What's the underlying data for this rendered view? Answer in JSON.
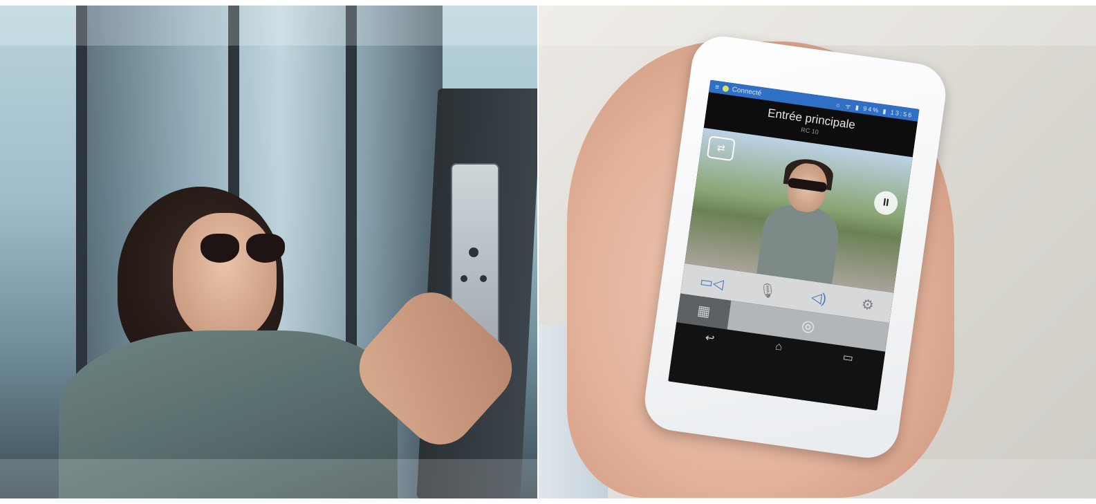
{
  "left_scene": {
    "description_labels": []
  },
  "phone_app": {
    "status_bar": {
      "app_name": "Connecté",
      "status_text": "☼ ᯤ ▮ 94% ▮ 13:56"
    },
    "camera": {
      "title": "Entrée principale",
      "subtitle": "RC 10"
    },
    "controls": {
      "camera": "▭◁",
      "mic": "🎙",
      "speaker": "◁)",
      "settings": "⚙"
    },
    "bottom": {
      "keypad": "▦",
      "answer": "◎"
    },
    "nav": {
      "back": "↩",
      "home": "⌂",
      "recent": "▭"
    },
    "video_buttons": {
      "swap": "⇄",
      "pause": "II"
    }
  },
  "colors": {
    "app_bar": "#2f6fc6",
    "screen_bg": "#111111",
    "controls_bg": "#d6d8da",
    "accent_icon": "#4a77b8"
  }
}
